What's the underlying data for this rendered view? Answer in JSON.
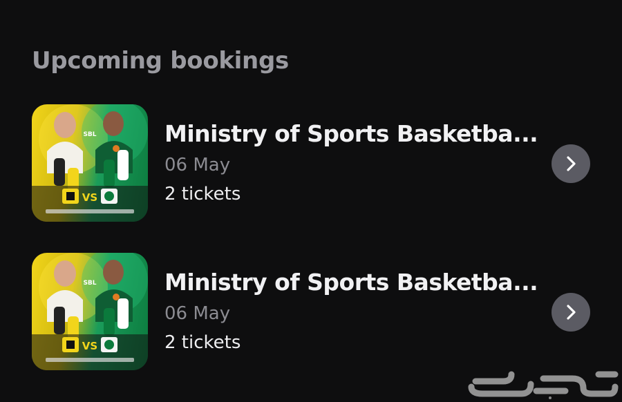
{
  "section": {
    "title": "Upcoming bookings"
  },
  "bookings": [
    {
      "title": "Ministry of Sports Basketba...",
      "date": "06 May",
      "tickets": "2 tickets",
      "poster": {
        "vs_label": "VS",
        "top_logo": "SBL"
      }
    },
    {
      "title": "Ministry of Sports Basketba...",
      "date": "06 May",
      "tickets": "2 tickets",
      "poster": {
        "vs_label": "VS",
        "top_logo": "SBL"
      }
    }
  ],
  "watermark": {
    "text": "حراج"
  },
  "colors": {
    "background": "#0e0e0f",
    "title_text": "#f1f1f3",
    "muted_text": "#8c8c92",
    "chevron_button": "#5b5b63",
    "poster_yellow": "#f2d51b",
    "poster_green": "#0c7a3e"
  },
  "icons": {
    "chevron": "chevron-right-icon"
  }
}
